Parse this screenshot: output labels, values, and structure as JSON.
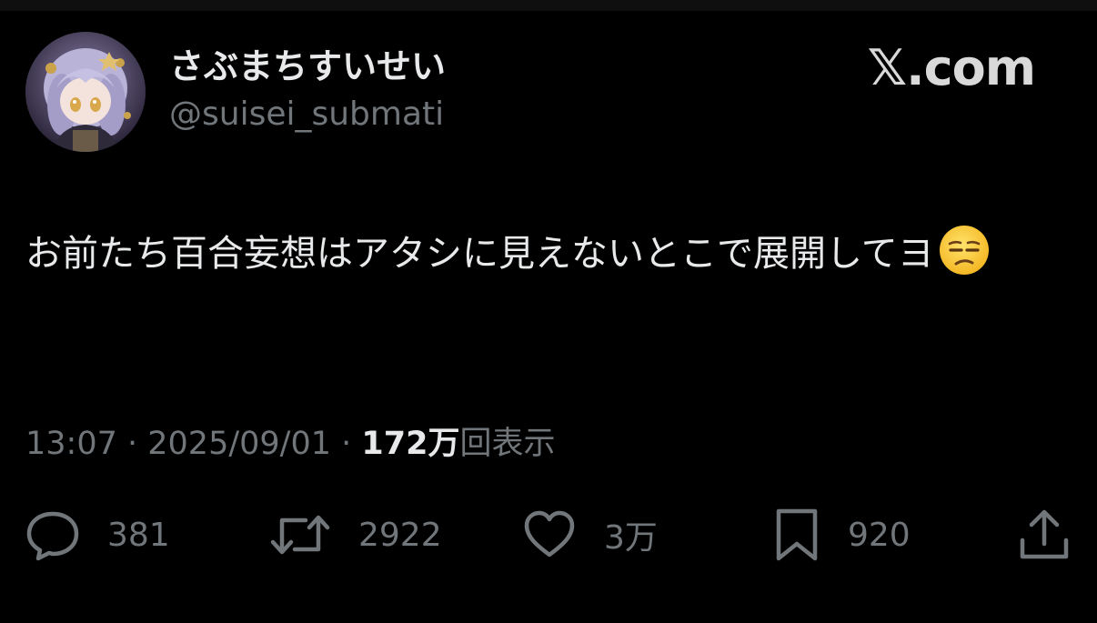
{
  "author": {
    "display_name": "さぶまちすいせい",
    "handle": "@suisei_submati",
    "avatar_icon": "avatar-image"
  },
  "brand": {
    "label": "𝕏.com"
  },
  "tweet": {
    "text": "お前たち百合妄想はアタシに見えないとこで展開してヨ",
    "emoji": "unamused-face-emoji"
  },
  "meta": {
    "time": "13:07",
    "separator1": " · ",
    "date": "2025/09/01",
    "separator2": " · ",
    "views_count": "172万",
    "views_label": "回表示"
  },
  "actions": {
    "reply": {
      "icon": "reply-icon",
      "count": "381"
    },
    "retweet": {
      "icon": "retweet-icon",
      "count": "2922"
    },
    "like": {
      "icon": "heart-icon",
      "count": "3万"
    },
    "bookmark": {
      "icon": "bookmark-icon",
      "count": "920"
    },
    "share": {
      "icon": "share-icon"
    }
  },
  "colors": {
    "background": "#000000",
    "primary_text": "#e7e9ea",
    "secondary_text": "#71767b"
  }
}
